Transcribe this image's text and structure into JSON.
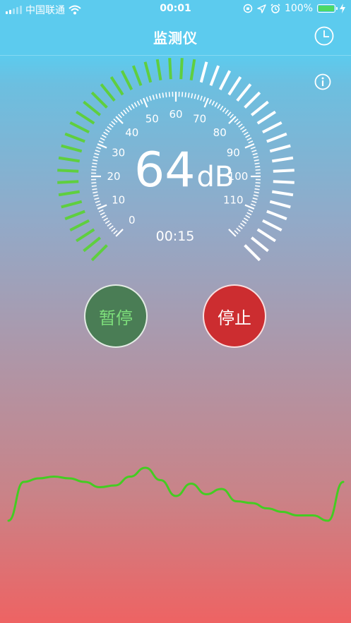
{
  "status_bar": {
    "carrier": "中国联通",
    "time": "00:01",
    "battery": "100%"
  },
  "nav": {
    "title": "监测仪"
  },
  "icons": {
    "history": "clock-icon",
    "info": "info-icon"
  },
  "gauge": {
    "value": 64,
    "unit": "dB",
    "min": 0,
    "max": 120,
    "tick_labels": [
      "0",
      "10",
      "20",
      "30",
      "40",
      "50",
      "60",
      "70",
      "80",
      "90",
      "100",
      "110"
    ],
    "reading_text": "64",
    "elapsed": "00:15",
    "active_color": "#5fcf3f",
    "inactive_color": "#ffffff"
  },
  "buttons": {
    "pause_label": "暂停",
    "stop_label": "停止"
  },
  "history_curve": {
    "color": "#44cc22",
    "values": [
      8,
      30,
      32,
      33,
      32,
      30,
      27,
      28,
      33,
      38,
      31,
      22,
      29,
      23,
      26,
      19,
      18,
      15,
      13,
      11,
      11,
      8,
      30
    ]
  }
}
